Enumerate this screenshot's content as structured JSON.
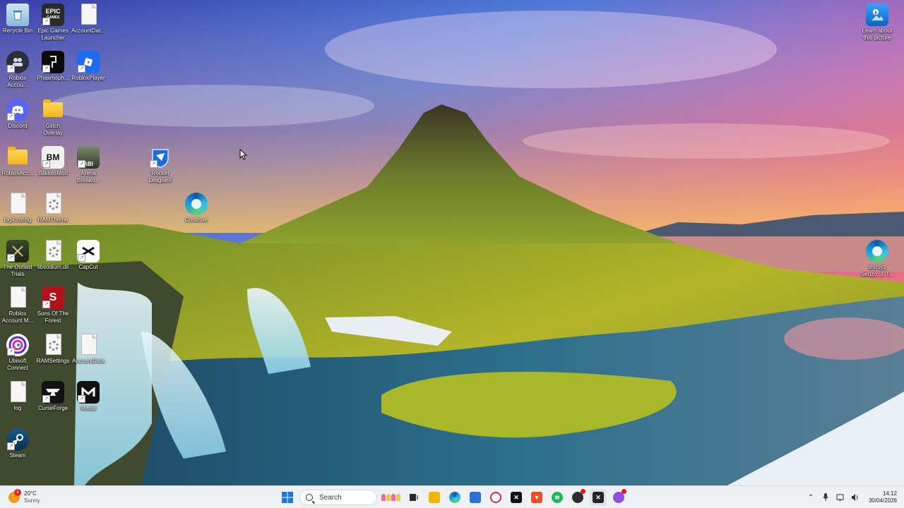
{
  "desktop": {
    "icons": [
      {
        "label": "Recycle Bin",
        "icon": "recycle-bin-icon"
      },
      {
        "label": "Epic Games Launcher",
        "icon": "epic-games-icon"
      },
      {
        "label": "AccountDat...",
        "icon": "document-icon"
      },
      {
        "label": "Roblox Accou...",
        "icon": "roblox-account-manager-icon"
      },
      {
        "label": "Phasmoph...",
        "icon": "phasmophobia-icon"
      },
      {
        "label": "RobloxPlayer",
        "icon": "roblox-player-icon"
      },
      {
        "label": "Discord",
        "icon": "discord-icon"
      },
      {
        "label": "Glitch Overlay",
        "icon": "folder-icon"
      },
      {
        "label": "RobloxAcc...",
        "icon": "folder-icon"
      },
      {
        "label": "BakkesMod",
        "icon": "bakkesmod-icon"
      },
      {
        "label": "Arena Breako...",
        "icon": "arena-breakout-icon"
      },
      {
        "label": "Rocket League®",
        "icon": "rocket-league-icon"
      },
      {
        "label": "log4.config",
        "icon": "document-icon"
      },
      {
        "label": "RAMTheme",
        "icon": "settings-file-icon"
      },
      {
        "label": "Continue",
        "icon": "edge-icon"
      },
      {
        "label": "The Outlast Trials",
        "icon": "outlast-trials-icon"
      },
      {
        "label": "libsodium.dll",
        "icon": "dll-file-icon"
      },
      {
        "label": "CapCut",
        "icon": "capcut-icon"
      },
      {
        "label": "Roblox Account M...",
        "icon": "document-icon"
      },
      {
        "label": "Sons Of The Forest",
        "icon": "sons-of-the-forest-icon"
      },
      {
        "label": "Ubisoft Connect",
        "icon": "ubisoft-connect-icon"
      },
      {
        "label": "RAMSettings",
        "icon": "settings-file-icon"
      },
      {
        "label": "AccountData",
        "icon": "document-icon"
      },
      {
        "label": "log",
        "icon": "document-icon"
      },
      {
        "label": "CurseForge",
        "icon": "curseforge-icon"
      },
      {
        "label": "Medal",
        "icon": "medal-icon"
      },
      {
        "label": "Steam",
        "icon": "steam-icon"
      },
      {
        "label": "Learn about this picture",
        "icon": "learn-about-picture-icon"
      },
      {
        "label": "shiroyz Senzo, J. T...",
        "icon": "edge-icon"
      }
    ]
  },
  "taskbar": {
    "weather": {
      "temp": "20°C",
      "condition": "Sunny",
      "badge": "1"
    },
    "search_placeholder": "Search",
    "apps": [
      {
        "name": "file-explorer-icon",
        "color": "#f4b400"
      },
      {
        "name": "edge-icon",
        "color": "#1d8ce0"
      },
      {
        "name": "microsoft-store-icon",
        "color": "#2a72d6"
      },
      {
        "name": "opera-gx-icon",
        "color": "#e3264a"
      },
      {
        "name": "capcut-icon",
        "color": "#111111"
      },
      {
        "name": "brave-icon",
        "color": "#f04b23"
      },
      {
        "name": "spotify-icon",
        "color": "#1db954"
      },
      {
        "name": "obs-icon",
        "color": "#302e31"
      },
      {
        "name": "active-app-icon",
        "color": "#222222"
      },
      {
        "name": "discord-icon",
        "color": "#8f4fe0"
      }
    ],
    "clock": {
      "time": "14:12",
      "date": "30/04/2026"
    }
  }
}
